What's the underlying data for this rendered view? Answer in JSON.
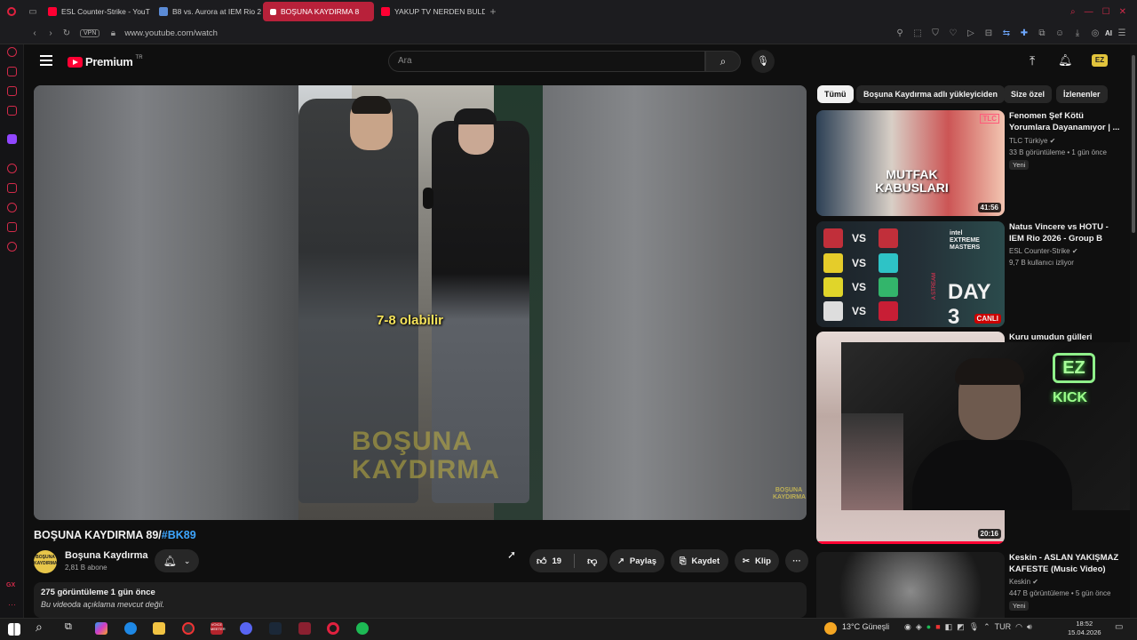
{
  "browser": {
    "tabs": [
      {
        "label": "ESL Counter-Strike - YouT",
        "color": "#ff0033",
        "active": false
      },
      {
        "label": "B8 vs. Aurora at IEM Rio 2",
        "color": "#5b8bd6",
        "active": false
      },
      {
        "label": "BOŞUNA KAYDIRMA 8",
        "color": "#ff0033",
        "active": true
      },
      {
        "label": "YAKUP TV NERDEN BULD",
        "color": "#ff0033",
        "active": false
      }
    ],
    "new_tab": "+",
    "vpn_badge": "VPN",
    "url": "www.youtube.com/watch",
    "ai_label": "AI"
  },
  "yt": {
    "logo_text": "Premium",
    "logo_suffix": "TR",
    "search_placeholder": "Ara",
    "ez_badge": "EZ"
  },
  "video": {
    "caption": "7-8 olabilir",
    "watermark_line1": "BOŞUNA",
    "watermark_line2": "KAYDIRMA",
    "corner_wm": "BOŞUNA KAYDIRMA",
    "title_main": "BOŞUNA KAYDIRMA 89/",
    "title_tag": "#BK89",
    "channel_name": "Boşuna Kaydırma",
    "channel_avatar_text": "BOŞUNA KAYDIRMA",
    "channel_subs": "2,81 B abone",
    "likes": "19",
    "share_label": "Paylaş",
    "save_label": "Kaydet",
    "clip_label": "Klip",
    "more_label": "···",
    "desc_stats": "275 görüntüleme  1 gün önce",
    "desc_text": "Bu videoda açıklama mevcut değil."
  },
  "chips": [
    "Tümü",
    "Boşuna Kaydırma adlı yükleyiciden",
    "Size özel",
    "İzlenenler"
  ],
  "recs": [
    {
      "title": "Fenomen Şef Kötü Yorumlara Dayanamıyor | ...",
      "channel": "TLC Türkiye",
      "meta": "33 B görüntüleme • 1 gün önce",
      "badge": "Yeni",
      "duration": "41:56",
      "thumb_text": "MUTFAK KABUSLARI",
      "thumb_logo": "TLC"
    },
    {
      "title": "Natus Vincere vs HOTU - IEM Rio 2026 - Group B",
      "channel": "ESL Counter-Strike",
      "meta": "9,7 B kullanıcı izliyor",
      "live": "CANLI",
      "thumb_text": "DAY 3",
      "thumb_vs": "VS",
      "thumb_brand": "intel EXTREME MASTERS",
      "thumb_stream": "A STREAM"
    },
    {
      "title": "Kuru umudun gülleri",
      "duration": "20:16"
    },
    {
      "title": "Keskin - ASLAN YAKIŞMAZ KAFESTE (Music Video)",
      "channel": "Keskin",
      "meta": "447 B görüntüleme • 5 gün önce",
      "badge": "Yeni"
    }
  ],
  "overlay": {
    "ez": "EZ",
    "kick": "KICK"
  },
  "rail_badge": "GX",
  "taskbar": {
    "weather": "13°C  Güneşli",
    "lang": "TUR",
    "time": "18:52",
    "date": "15.04.2026",
    "vodafone": "VOICE MEETER"
  }
}
